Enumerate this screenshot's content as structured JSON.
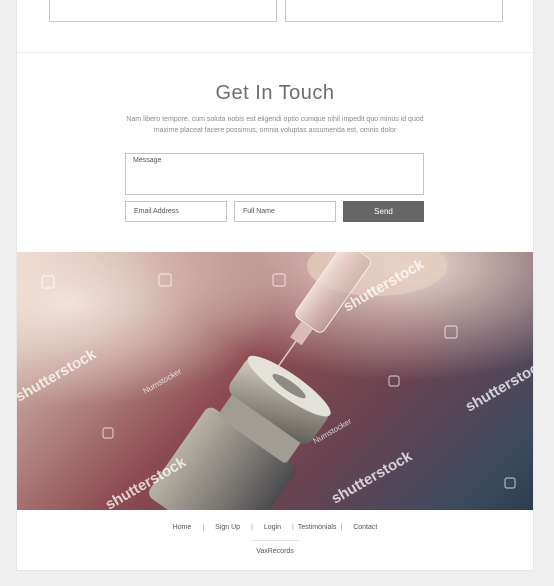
{
  "contact": {
    "title": "Get In Touch",
    "description": "Nam libero tempore, cum soluta nobis est eligendi optio cumque nihil impedit quo minus id quod maxime placeat facere possimus, omnia voluptas assumenda est, omnis dolor",
    "message_placeholder": "Message",
    "email_placeholder": "Email Address",
    "name_placeholder": "Full Name",
    "send_label": "Send"
  },
  "hero": {
    "watermark_main": "shutterstock",
    "watermark_author": "Numstocker"
  },
  "footer": {
    "nav": [
      "Home",
      "Sign Up",
      "Login",
      "Testimonials",
      "Contact"
    ],
    "divider": "|",
    "brand": "VaxRecords"
  },
  "colors": {
    "send_button": "#666666",
    "title_text": "#6d6d6d",
    "page_background": "#efefef"
  }
}
